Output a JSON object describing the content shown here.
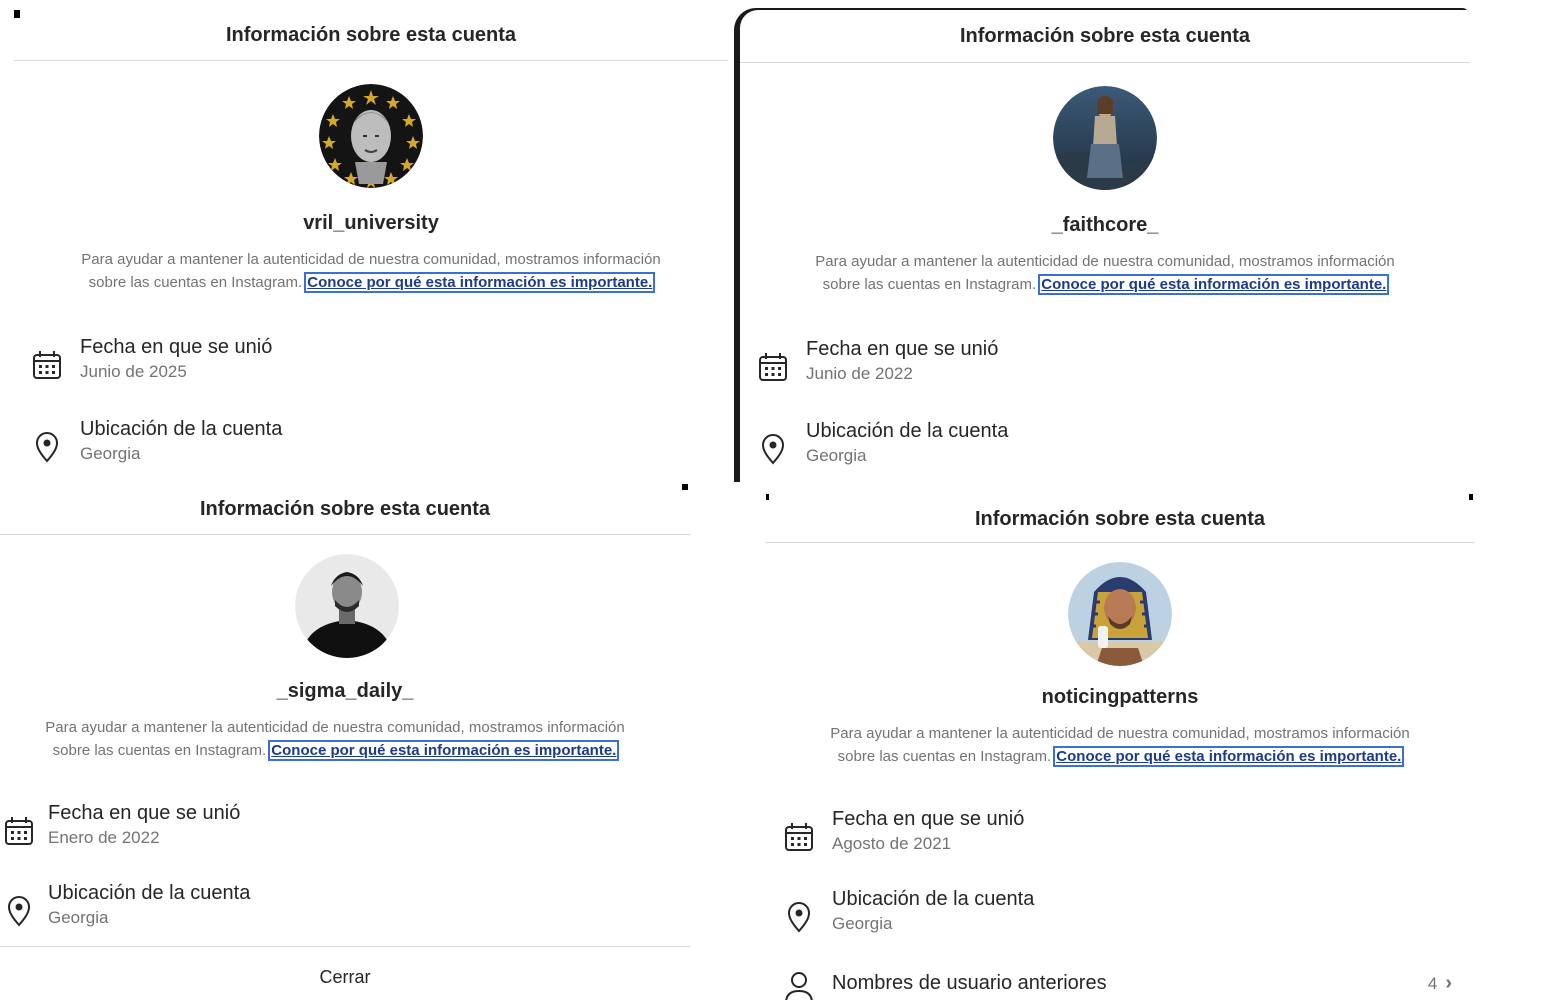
{
  "header_title": "Información sobre esta cuenta",
  "description": "Para ayudar a mantener la autenticidad de nuestra comunidad, mostramos información sobre las cuentas en Instagram.",
  "description_line1": "Para ayudar a mantener la autenticidad de nuestra comunidad, mostramos información",
  "description_line2": "sobre las cuentas en Instagram.",
  "learn_more_link": "Conoce por qué esta información es importante.",
  "joined_label": "Fecha en que se unió",
  "location_label": "Ubicación de la cuenta",
  "close_label": "Cerrar",
  "former_usernames_label": "Nombres de usuario anteriores",
  "accent_link_color": "#1b3b8a",
  "accounts": [
    {
      "username": "vril_university",
      "joined": "Junio de 2025",
      "location": "Georgia"
    },
    {
      "username": "_faithcore_",
      "joined": "Junio de 2022",
      "location": "Georgia"
    },
    {
      "username": "_sigma_daily_",
      "joined": "Enero de 2022",
      "location": "Georgia"
    },
    {
      "username": "noticingpatterns",
      "joined": "Agosto de 2021",
      "location": "Georgia",
      "former_usernames_count": "4"
    }
  ]
}
